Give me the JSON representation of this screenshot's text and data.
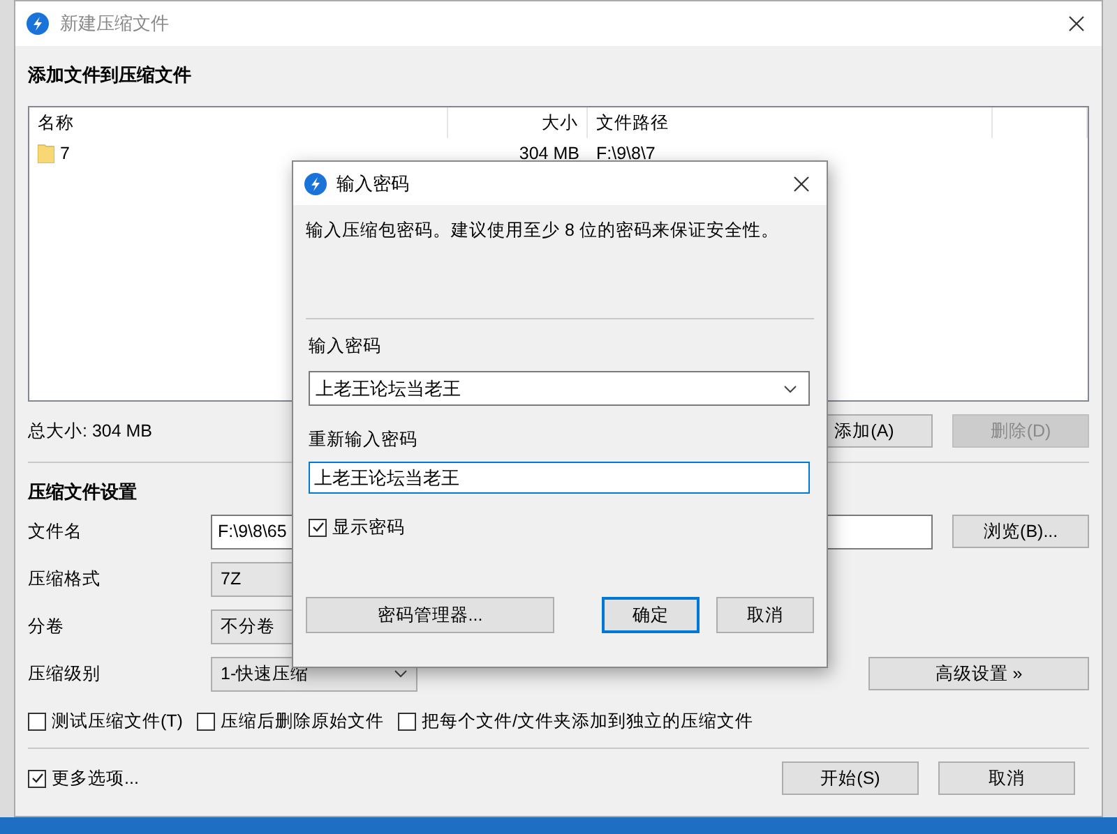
{
  "window": {
    "title": "新建压缩文件"
  },
  "files": {
    "heading": "添加文件到压缩文件",
    "columns": [
      "名称",
      "大小",
      "文件路径"
    ],
    "rows": [
      {
        "name": "7",
        "size": "304 MB",
        "path": "F:\\9\\8\\7"
      }
    ]
  },
  "total_size": "总大小: 304 MB",
  "file_buttons": [
    {
      "label": "添加(A)",
      "disabled": false
    },
    {
      "label": "删除(D)",
      "disabled": true
    }
  ],
  "settings": {
    "heading": "压缩文件设置",
    "fields": [
      {
        "label": "文件名",
        "kind": "text",
        "value": "F:\\9\\8\\65"
      },
      {
        "label": "压缩格式",
        "kind": "covered_combo",
        "value": "7Z"
      },
      {
        "label": "分卷",
        "kind": "covered_combo",
        "value": "不分卷"
      },
      {
        "label": "压缩级别",
        "kind": "combo",
        "value": "1-快速压缩"
      }
    ],
    "browse_button": "浏览(B)...",
    "advanced_button": "高级设置 »"
  },
  "options": [
    {
      "label": "测试压缩文件(T)",
      "checked": false
    },
    {
      "label": "压缩后删除原始文件",
      "checked": false
    },
    {
      "label": "把每个文件/文件夹添加到独立的压缩文件",
      "checked": false
    }
  ],
  "more_options": {
    "label": "更多选项...",
    "checked": true
  },
  "buttons": [
    "开始(S)",
    "取消"
  ],
  "dialog": {
    "title": "输入密码",
    "description": "输入压缩包密码。建议使用至少 8 位的密码来保证安全性。",
    "password_label": "输入密码",
    "password": "上老王论坛当老王",
    "confirm_label": "重新输入密码",
    "confirm": "上老王论坛当老王",
    "show_password": {
      "label": "显示密码",
      "checked": true
    },
    "manager_button": "密码管理器...",
    "buttons": [
      {
        "label": "确定",
        "default": true
      },
      {
        "label": "取消",
        "default": false
      }
    ]
  }
}
